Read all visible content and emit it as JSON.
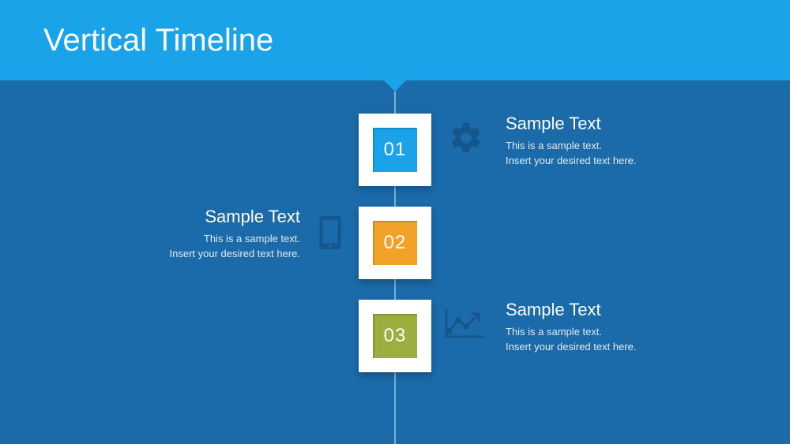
{
  "header": {
    "title": "Vertical Timeline"
  },
  "colors": {
    "header_bg": "#1aa3e8",
    "main_bg": "#1b6aa9",
    "block1": "#1aa3e8",
    "block2": "#f1a229",
    "block3": "#9aaf3f",
    "icon": "#15578c"
  },
  "timeline": [
    {
      "number": "01",
      "side": "right",
      "icon": "gear-icon",
      "heading": "Sample Text",
      "body_line1": "This is a sample text.",
      "body_line2": "Insert your desired text here."
    },
    {
      "number": "02",
      "side": "left",
      "icon": "tablet-icon",
      "heading": "Sample Text",
      "body_line1": "This is a sample text.",
      "body_line2": "Insert your desired text here."
    },
    {
      "number": "03",
      "side": "right",
      "icon": "chart-icon",
      "heading": "Sample Text",
      "body_line1": "This is a sample text.",
      "body_line2": "Insert your desired text here."
    }
  ]
}
